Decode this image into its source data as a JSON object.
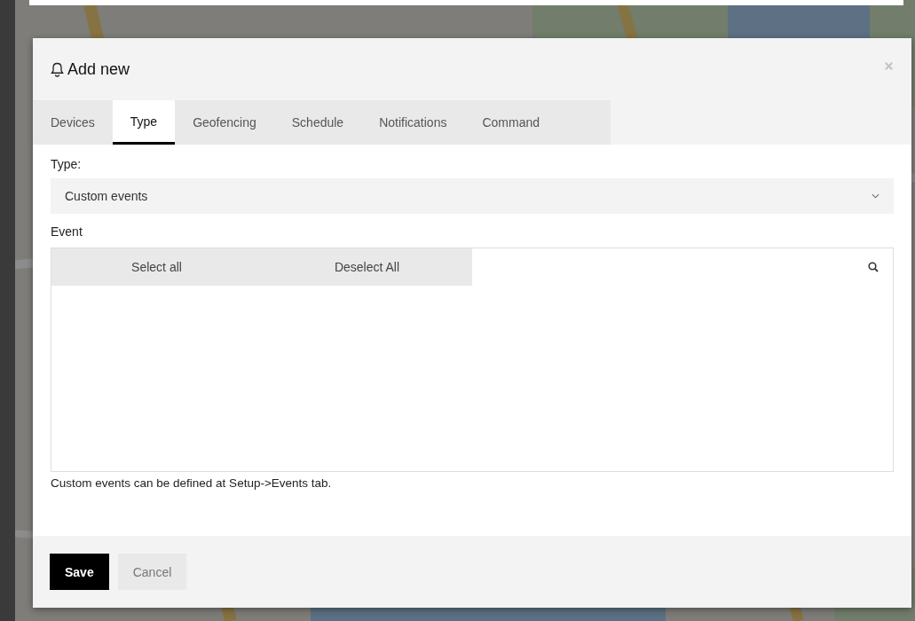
{
  "dialog": {
    "title": "Add new",
    "tabs": [
      {
        "label": "Devices",
        "selected": false
      },
      {
        "label": "Type",
        "selected": true
      },
      {
        "label": "Geofencing",
        "selected": false
      },
      {
        "label": "Schedule",
        "selected": false
      },
      {
        "label": "Notifications",
        "selected": false
      },
      {
        "label": "Command",
        "selected": false
      }
    ],
    "type_label": "Type:",
    "type_select": {
      "value": "Custom events"
    },
    "event_label": "Event",
    "event_list": {
      "select_all": "Select all",
      "deselect_all": "Deselect All"
    },
    "hint": "Custom events can be defined at Setup->Events tab.",
    "buttons": [
      {
        "label": "Save",
        "kind": "primary"
      },
      {
        "label": "Cancel",
        "kind": "secondary"
      }
    ]
  }
}
